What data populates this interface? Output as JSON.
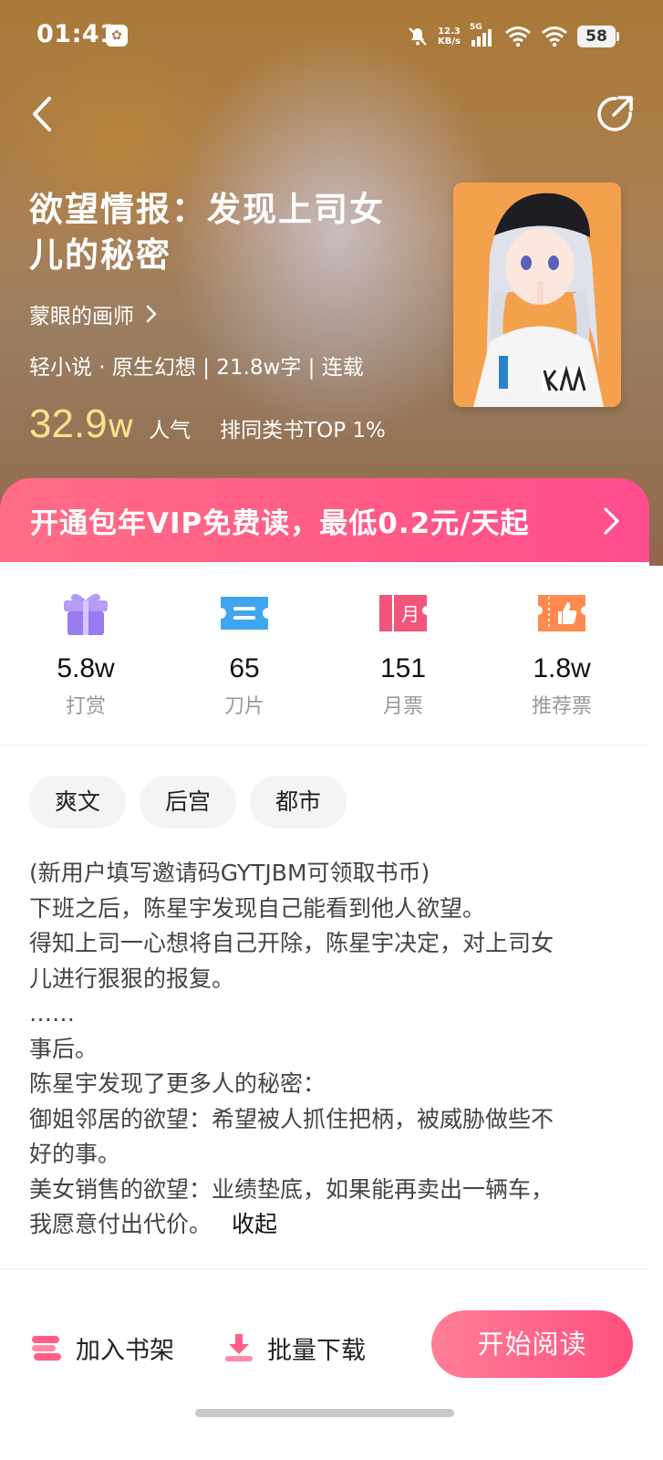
{
  "status_bar": {
    "time": "01:41",
    "net_speed_value": "12.3",
    "net_speed_unit": "KB/s",
    "network": "5G",
    "battery": "58"
  },
  "book": {
    "title": "欲望情报：发现上司女儿的秘密",
    "author": "蒙眼的画师",
    "meta": "轻小说 · 原生幻想 | 21.8w字 | 连载",
    "popularity_value": "32.9",
    "popularity_unit": "w",
    "popularity_label": "人气",
    "rank_text": "排同类书TOP 1%"
  },
  "vip_banner": {
    "text": "开通包年VIP免费读，最低0.2元/天起"
  },
  "stats": [
    {
      "value": "5.8w",
      "label": "打赏",
      "icon": "gift-icon"
    },
    {
      "value": "65",
      "label": "刀片",
      "icon": "blade-ticket-icon"
    },
    {
      "value": "151",
      "label": "月票",
      "icon": "monthly-ticket-icon"
    },
    {
      "value": "1.8w",
      "label": "推荐票",
      "icon": "recommend-ticket-icon"
    }
  ],
  "monthly_ticket_glyph": "月",
  "tags": [
    "爽文",
    "后宫",
    "都市"
  ],
  "description": {
    "lines": [
      "(新用户填写邀请码GYTJBM可领取书币)",
      "下班之后，陈星宇发现自己能看到他人欲望。",
      "得知上司一心想将自己开除，陈星宇决定，对上司女",
      "儿进行狠狠的报复。",
      "……",
      "事后。",
      "陈星宇发现了更多人的秘密：",
      "御姐邻居的欲望：希望被人抓住把柄，被威胁做些不",
      "好的事。",
      "美女销售的欲望：业绩垫底，如果能再卖出一辆车，",
      "我愿意付出代价。"
    ],
    "collapse_label": "收起"
  },
  "bottom_bar": {
    "add_shelf": "加入书架",
    "batch_download": "批量下载",
    "start_reading": "开始阅读"
  },
  "colors": {
    "accent_pink": "#ff5a86",
    "popularity_yellow": "#ffe08a"
  }
}
